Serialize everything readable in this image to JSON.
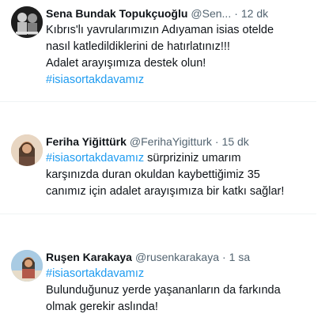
{
  "tweets": [
    {
      "name": "Sena Bundak Topukçuoğlu",
      "handle": "@Sen...",
      "separator": "·",
      "time": "12 dk",
      "lines": [
        {
          "text": "Kıbrıs'lı yavrularımızın Adıyaman isias otelde",
          "hashtag": ""
        },
        {
          "text": "nasıl katledildiklerini de hatırlatınız!!!",
          "hashtag": ""
        },
        {
          "text": "Adalet arayışımıza destek olun!",
          "hashtag": ""
        },
        {
          "text": "",
          "hashtag": "#isiasortakdavamız"
        }
      ]
    },
    {
      "name": "Feriha Yiğittürk",
      "handle": "@FerihaYigitturk",
      "separator": "·",
      "time": "15 dk",
      "lines": [
        {
          "text": " sürpriziniz umarım",
          "hashtag": "#isiasortakdavamız"
        },
        {
          "text": "karşınızda duran okuldan kaybettiğimiz 35",
          "hashtag": ""
        },
        {
          "text": "canımız için adalet arayışımıza bir katkı sağlar!",
          "hashtag": ""
        }
      ]
    },
    {
      "name": "Ruşen Karakaya",
      "handle": "@rusenkarakaya",
      "separator": "·",
      "time": "1 sa",
      "lines": [
        {
          "text": "",
          "hashtag": "#isiasortakdavamız"
        },
        {
          "text": "Bulunduğunuz yerde yaşananların da farkında",
          "hashtag": ""
        },
        {
          "text": "olmak gerekir aslında!",
          "hashtag": ""
        }
      ]
    }
  ]
}
